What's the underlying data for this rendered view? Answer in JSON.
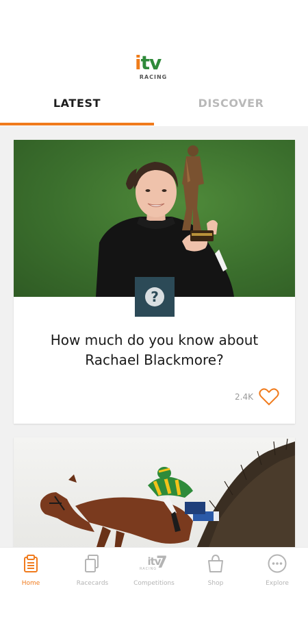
{
  "header": {
    "logo": {
      "wordmark": "itv",
      "sub": "RACING"
    },
    "tabs": [
      {
        "label": "LATEST",
        "active": true
      },
      {
        "label": "DISCOVER",
        "active": false
      }
    ],
    "accent_color": "#f07b1d"
  },
  "feed": {
    "cards": [
      {
        "image": "jockey-holding-trophy-photo",
        "badge_icon": "question-mark-icon",
        "title": "How much do you know about Rachael Blackmore?",
        "likes": "2.4K",
        "like_icon": "heart-icon"
      },
      {
        "image": "horse-jumping-fence-photo"
      }
    ]
  },
  "bottom_nav": {
    "items": [
      {
        "label": "Home",
        "icon": "clipboard-icon",
        "active": true
      },
      {
        "label": "Racecards",
        "icon": "cards-icon",
        "active": false
      },
      {
        "label": "Competitions",
        "icon": "itv7-icon",
        "active": false
      },
      {
        "label": "Shop",
        "icon": "shopping-bag-icon",
        "active": false
      },
      {
        "label": "Explore",
        "icon": "more-icon",
        "active": false
      }
    ],
    "itv7_text": {
      "t": "itv",
      "seven": "7",
      "r": "RACING"
    }
  }
}
